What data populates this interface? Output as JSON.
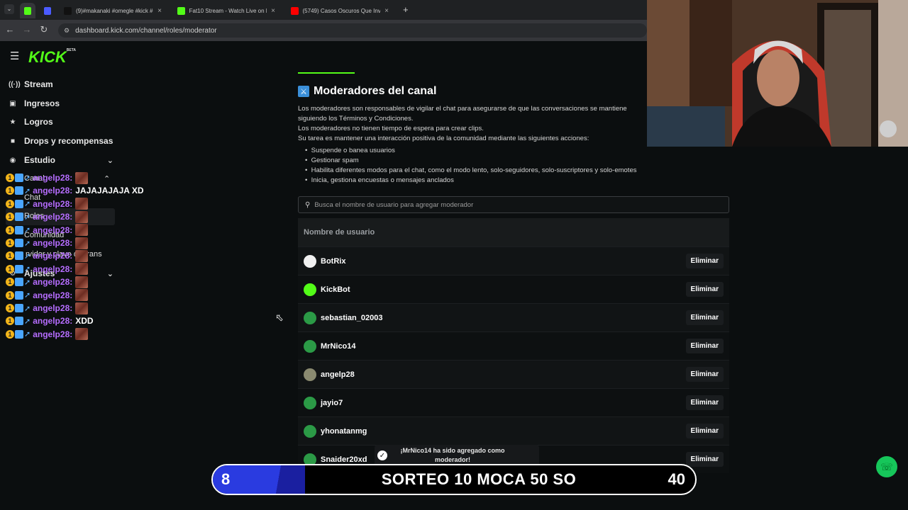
{
  "browser": {
    "tabs": [
      {
        "label": "",
        "fav_color": "#53fc18"
      },
      {
        "label": "",
        "fav_color": "#4b5bff"
      },
      {
        "label": "(9)#makanaki #omegle #kick #",
        "fav_color": "#111111"
      },
      {
        "label": "Fat10 Stream - Watch Live on K",
        "fav_color": "#53fc18"
      },
      {
        "label": "(5749) Casos Oscuros Que Inve",
        "fav_color": "#ff0000"
      }
    ],
    "url": "dashboard.kick.com/channel/roles/moderator"
  },
  "sidebar": {
    "logo": "KICK",
    "logo_badge": "BETA",
    "items": [
      {
        "label": "Stream",
        "icon": "radio-icon"
      },
      {
        "label": "Ingresos",
        "icon": "wallet-icon"
      },
      {
        "label": "Logros",
        "icon": "trophy-icon"
      },
      {
        "label": "Drops y recompensas",
        "icon": "gift-icon"
      },
      {
        "label": "Estudio",
        "icon": "studio-icon"
      }
    ],
    "sub_canal": "Canal",
    "sub_chat": "Chat",
    "sub_roles": "Roles",
    "sub_comunidad": "Comunidad",
    "sub_servidores": "rvidor y clave de trans",
    "ajustes": "Ajustes"
  },
  "chat": {
    "username": "angelp28:",
    "badge_num": "1",
    "lines": [
      {
        "msg": "",
        "emote": true
      },
      {
        "msg": "JAJAJAJAJA XD",
        "emote": false
      },
      {
        "msg": "",
        "emote": true
      },
      {
        "msg": "",
        "emote": true
      },
      {
        "msg": "",
        "emote": true
      },
      {
        "msg": "",
        "emote": true
      },
      {
        "msg": "",
        "emote": true
      },
      {
        "msg": "",
        "emote": true
      },
      {
        "msg": "",
        "emote": true
      },
      {
        "msg": "",
        "emote": true
      },
      {
        "msg": "",
        "emote": true
      },
      {
        "msg": "XDD",
        "emote": false
      },
      {
        "msg": "",
        "emote": true
      }
    ]
  },
  "main": {
    "title": "Moderadores del canal",
    "desc": [
      "Los moderadores son responsables de vigilar el chat para asegurarse de que las conversaciones se mantiene",
      "siguiendo los Términos y Condiciones.",
      "Los moderadores no tienen tiempo de espera para crear clips.",
      "Su tarea es mantener una interacción positiva de la comunidad mediante las siguientes acciones:"
    ],
    "bullets": [
      "Suspende o banea usuarios",
      "Gestionar spam",
      "Habilita diferentes modos para el chat, como el modo lento, solo-seguidores, solo-suscriptores y solo-emotes",
      "Inicia, gestiona encuestas o mensajes anclados"
    ],
    "search_placeholder": "Busca el nombre de usuario para agregar moderador",
    "table_header": "Nombre de usuario",
    "delete_label": "Eliminar",
    "moderators": [
      {
        "name": "BotRix",
        "avatar_color": "#f0f0f0"
      },
      {
        "name": "KickBot",
        "avatar_color": "#53fc18"
      },
      {
        "name": "sebastian_02003",
        "avatar_color": "#2b9a46"
      },
      {
        "name": "MrNico14",
        "avatar_color": "#2b9a46"
      },
      {
        "name": "angelp28",
        "avatar_color": "#8a8a70"
      },
      {
        "name": "jayio7",
        "avatar_color": "#2b9a46"
      },
      {
        "name": "yhonatanmg",
        "avatar_color": "#2b9a46"
      },
      {
        "name": "Snaider20xd",
        "avatar_color": "#2b9a46"
      }
    ]
  },
  "toast": {
    "text": "¡MrNico14 ha sido agregado como moderador!"
  },
  "banner": {
    "left_num": "8",
    "text": "SORTEO 10 MOCA 50 SO",
    "right_num": "40"
  }
}
